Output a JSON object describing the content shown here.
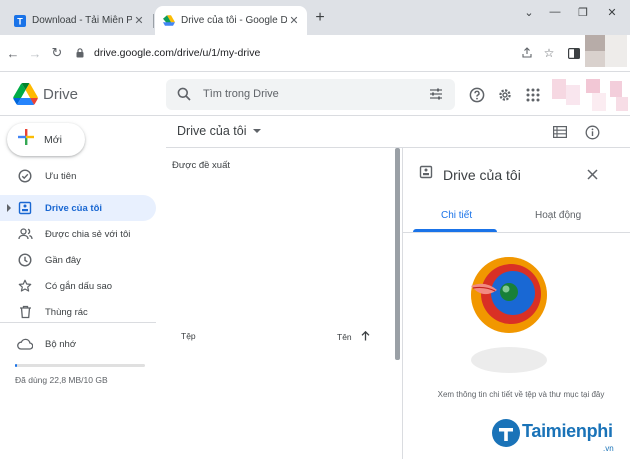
{
  "browser": {
    "tabs": [
      {
        "title": "Download - Tải Miễn Phí VN - P",
        "active": false
      },
      {
        "title": "Drive của tôi - Google Drive",
        "active": true
      }
    ],
    "new_tab_label": "+",
    "url": "drive.google.com/drive/u/1/my-drive"
  },
  "header": {
    "brand": "Drive",
    "search_placeholder": "Tìm trong Drive"
  },
  "sidebar": {
    "new_button": "Mới",
    "items": [
      {
        "label": "Ưu tiên",
        "icon": "priority-check-icon",
        "active": false
      },
      {
        "label": "Drive của tôi",
        "icon": "my-drive-icon",
        "active": true
      },
      {
        "label": "Được chia sẻ với tôi",
        "icon": "shared-people-icon",
        "active": false
      },
      {
        "label": "Gần đây",
        "icon": "clock-icon",
        "active": false
      },
      {
        "label": "Có gắn dấu sao",
        "icon": "star-icon",
        "active": false
      },
      {
        "label": "Thùng rác",
        "icon": "trash-icon",
        "active": false
      }
    ],
    "storage_label": "Bộ nhớ",
    "storage_used": "Đã dùng 22,8 MB/10 GB",
    "storage_fraction": 0.002
  },
  "main": {
    "title": "Drive của tôi",
    "suggested": "Được đề xuất",
    "file_column": "Tệp",
    "name_column": "Tên"
  },
  "details": {
    "title": "Drive của tôi",
    "tabs": [
      "Chi tiết",
      "Hoạt động"
    ],
    "active_tab": 0,
    "message": "Xem thông tin chi tiết về tệp và thư mục tại đây"
  },
  "watermark": {
    "text": "Taimienphi",
    "suffix": ".vn"
  },
  "colors": {
    "accent": "#1a73e8",
    "active_nav_bg": "#e8f0fe",
    "tabstrip": "#dee1e6"
  }
}
